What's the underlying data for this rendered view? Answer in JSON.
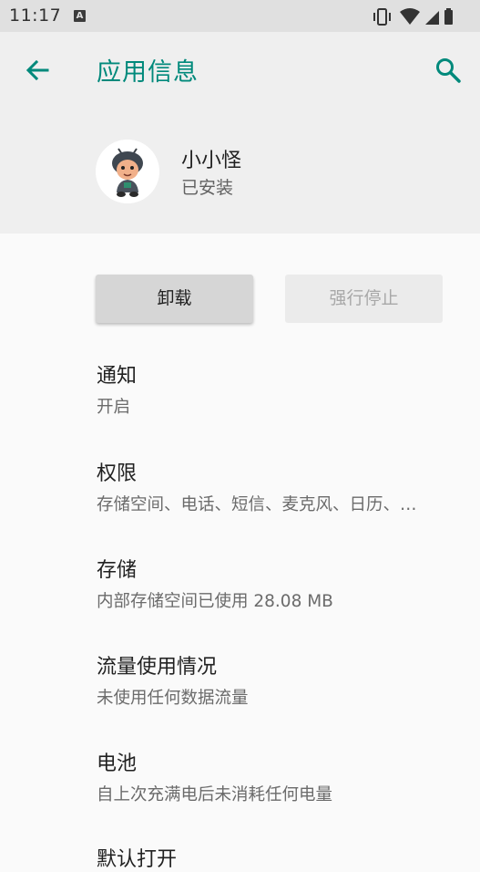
{
  "status_bar": {
    "time": "11:17",
    "notification_icon": "A"
  },
  "header": {
    "title": "应用信息",
    "back_icon": "arrow-back-icon",
    "search_icon": "search-icon"
  },
  "app": {
    "name": "小小怪",
    "status": "已安装"
  },
  "buttons": {
    "uninstall": "卸载",
    "force_stop": "强行停止"
  },
  "items": [
    {
      "title": "通知",
      "summary": "开启"
    },
    {
      "title": "权限",
      "summary": "存储空间、电话、短信、麦克风、日历、…"
    },
    {
      "title": "存储",
      "summary": "内部存储空间已使用 28.08 MB"
    },
    {
      "title": "流量使用情况",
      "summary": "未使用任何数据流量"
    },
    {
      "title": "电池",
      "summary": "自上次充满电后未消耗任何电量"
    },
    {
      "title": "默认打开",
      "summary": ""
    }
  ],
  "colors": {
    "accent": "#00897b",
    "header_bg": "#efefef",
    "status_bar_bg": "#e0e0e0"
  }
}
